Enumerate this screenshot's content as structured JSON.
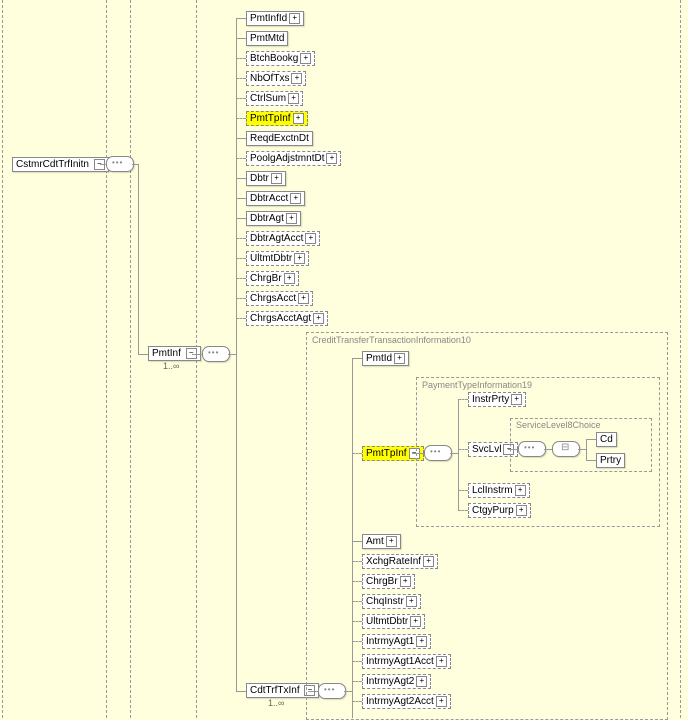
{
  "root": {
    "label": "CstmrCdtTrfInitn"
  },
  "pmtInf": {
    "label": "PmtInf",
    "cardinality": "1..∞"
  },
  "cdtTrfTxInf": {
    "label": "CdtTrfTxInf",
    "cardinality": "1..∞"
  },
  "pmtInfChildren": {
    "pmtInfId": "PmtInfId",
    "pmtMtd": "PmtMtd",
    "btchBookg": "BtchBookg",
    "nbOfTxs": "NbOfTxs",
    "ctrlSum": "CtrlSum",
    "pmtTpInf": "PmtTpInf",
    "reqdExctnDt": "ReqdExctnDt",
    "poolgAdjstmntDt": "PoolgAdjstmntDt",
    "dbtr": "Dbtr",
    "dbtrAcct": "DbtrAcct",
    "dbtrAgt": "DbtrAgt",
    "dbtrAgtAcct": "DbtrAgtAcct",
    "ultmtDbtr": "UltmtDbtr",
    "chrgBr": "ChrgBr",
    "chrgsAcct": "ChrgsAcct",
    "chrgsAcctAgt": "ChrgsAcctAgt"
  },
  "cdtTrfChildren": {
    "pmtId": "PmtId",
    "pmtTpInf": "PmtTpInf",
    "amt": "Amt",
    "xchgRateInf": "XchgRateInf",
    "chrgBr": "ChrgBr",
    "chqInstr": "ChqInstr",
    "ultmtDbtr": "UltmtDbtr",
    "intrmyAgt1": "IntrmyAgt1",
    "intrmyAgt1Acct": "IntrmyAgt1Acct",
    "intrmyAgt2": "IntrmyAgt2",
    "intrmyAgt2Acct": "IntrmyAgt2Acct"
  },
  "groups": {
    "cdtTrf": "CreditTransferTransactionInformation10",
    "pmtTp": "PaymentTypeInformation19",
    "svcLvl": "ServiceLevel8Choice"
  },
  "pmtTpChildren": {
    "instrPrty": "InstrPrty",
    "svcLvl": "SvcLvl",
    "lclInstrm": "LclInstrm",
    "ctgyPurp": "CtgyPurp"
  },
  "svcLvlChildren": {
    "cd": "Cd",
    "prtry": "Prtry"
  }
}
